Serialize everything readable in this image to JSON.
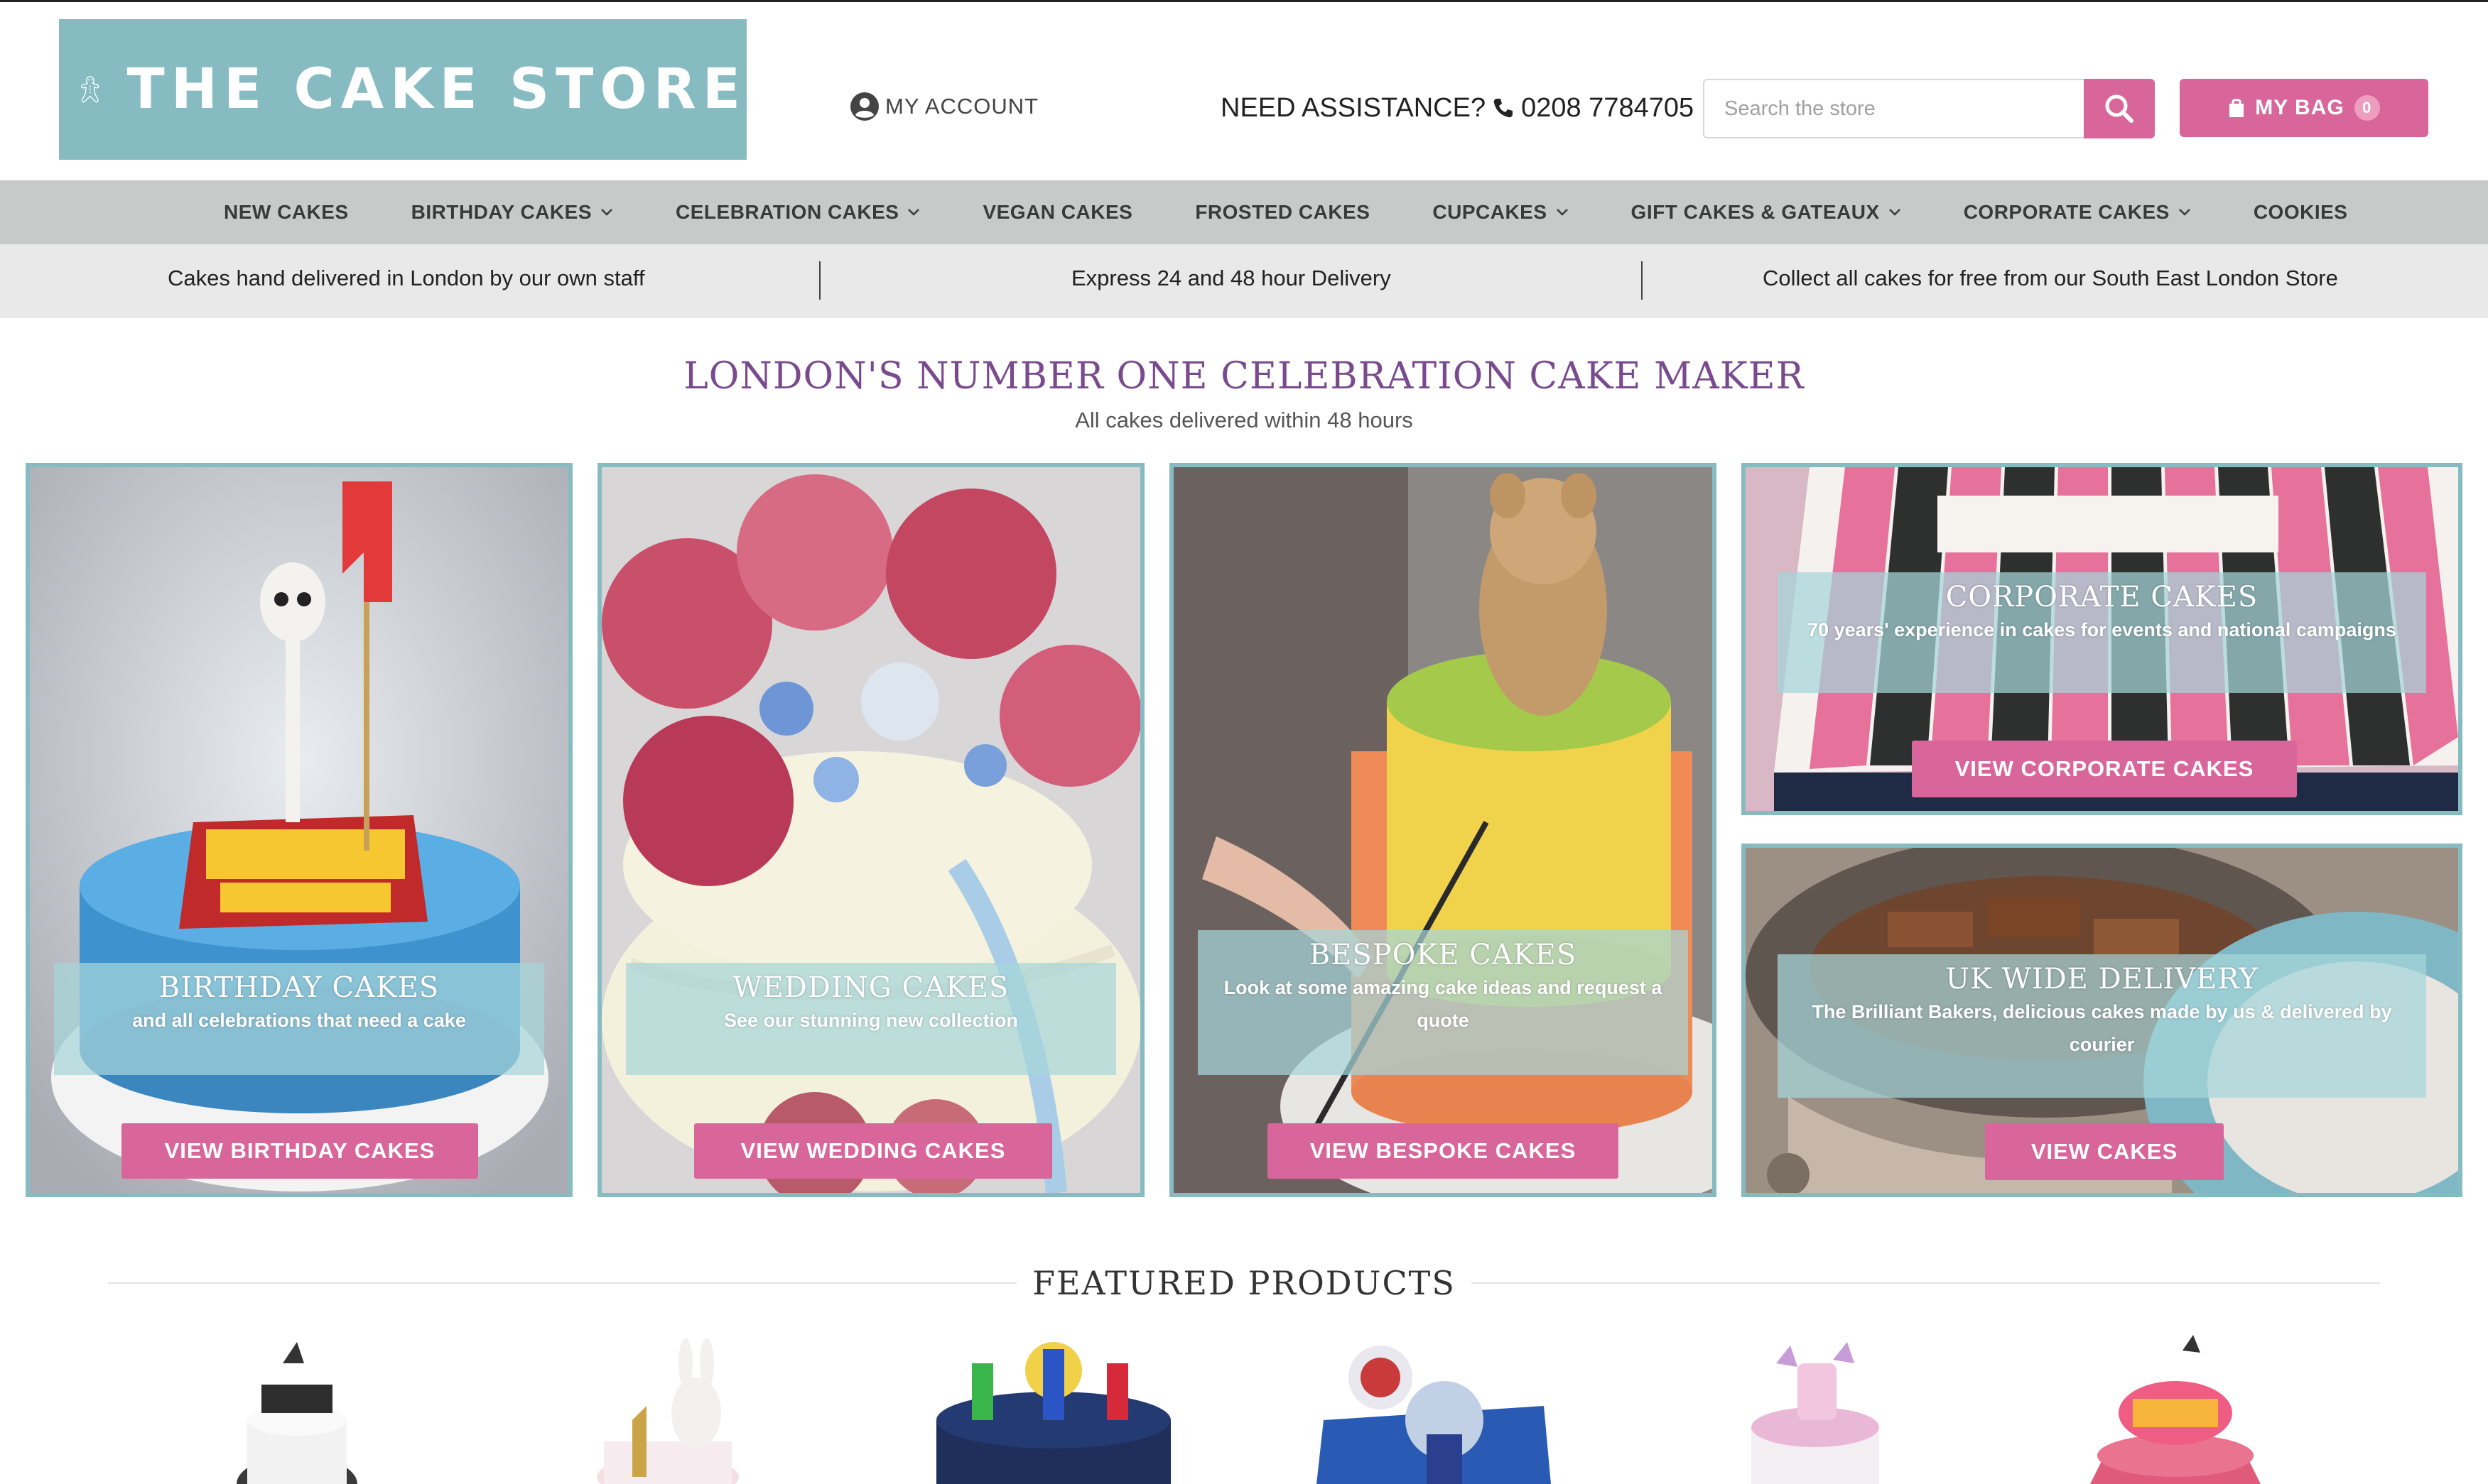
{
  "header": {
    "logo_text": "THE CAKE STORE",
    "account_label": "MY ACCOUNT",
    "assist_label": "NEED ASSISTANCE?",
    "phone": "0208 7784705",
    "search_placeholder": "Search the store",
    "bag_label": "MY BAG",
    "bag_count": "0"
  },
  "nav": {
    "items": [
      {
        "label": "NEW CAKES",
        "dropdown": false
      },
      {
        "label": "BIRTHDAY CAKES",
        "dropdown": true
      },
      {
        "label": "CELEBRATION CAKES",
        "dropdown": true
      },
      {
        "label": "VEGAN CAKES",
        "dropdown": false
      },
      {
        "label": "FROSTED CAKES",
        "dropdown": false
      },
      {
        "label": "CUPCAKES",
        "dropdown": true
      },
      {
        "label": "GIFT CAKES & GATEAUX",
        "dropdown": true
      },
      {
        "label": "CORPORATE CAKES",
        "dropdown": true
      },
      {
        "label": "COOKIES",
        "dropdown": false
      }
    ]
  },
  "infobar": {
    "left": "Cakes hand delivered in London by our own staff",
    "center": "Express 24 and 48 hour Delivery",
    "right": "Collect all cakes for free from our South East London Store"
  },
  "hero": {
    "headline": "LONDON'S NUMBER ONE CELEBRATION CAKE MAKER",
    "subline": "All cakes delivered within 48 hours"
  },
  "cards": {
    "birthday": {
      "title": "BIRTHDAY CAKES",
      "subtitle": "and all celebrations that need a cake",
      "button": "VIEW BIRTHDAY CAKES"
    },
    "wedding": {
      "title": "WEDDING CAKES",
      "subtitle": "See our stunning new collection",
      "button": "VIEW WEDDING CAKES"
    },
    "bespoke": {
      "title": "BESPOKE CAKES",
      "subtitle": "Look at some amazing cake ideas and request a quote",
      "button": "VIEW BESPOKE CAKES"
    },
    "corporate": {
      "title": "CORPORATE CAKES",
      "subtitle": "70 years' experience in cakes for events and national campaigns",
      "button": "VIEW CORPORATE CAKES"
    },
    "delivery": {
      "title": "UK WIDE DELIVERY",
      "subtitle": "The Brilliant Bakers, delicious cakes made by us & delivered by courier",
      "button": "VIEW CAKES"
    }
  },
  "featured": {
    "title": "FEATURED PRODUCTS"
  },
  "colors": {
    "brand_teal": "#86bcc1",
    "accent_pink": "#d9669a",
    "headline_purple": "#7a4a8e",
    "nav_grey": "#c8c9c9"
  },
  "icons": [
    "gingerbread-man-icon",
    "account-icon",
    "phone-icon",
    "search-icon",
    "bag-icon",
    "chevron-down-icon"
  ]
}
